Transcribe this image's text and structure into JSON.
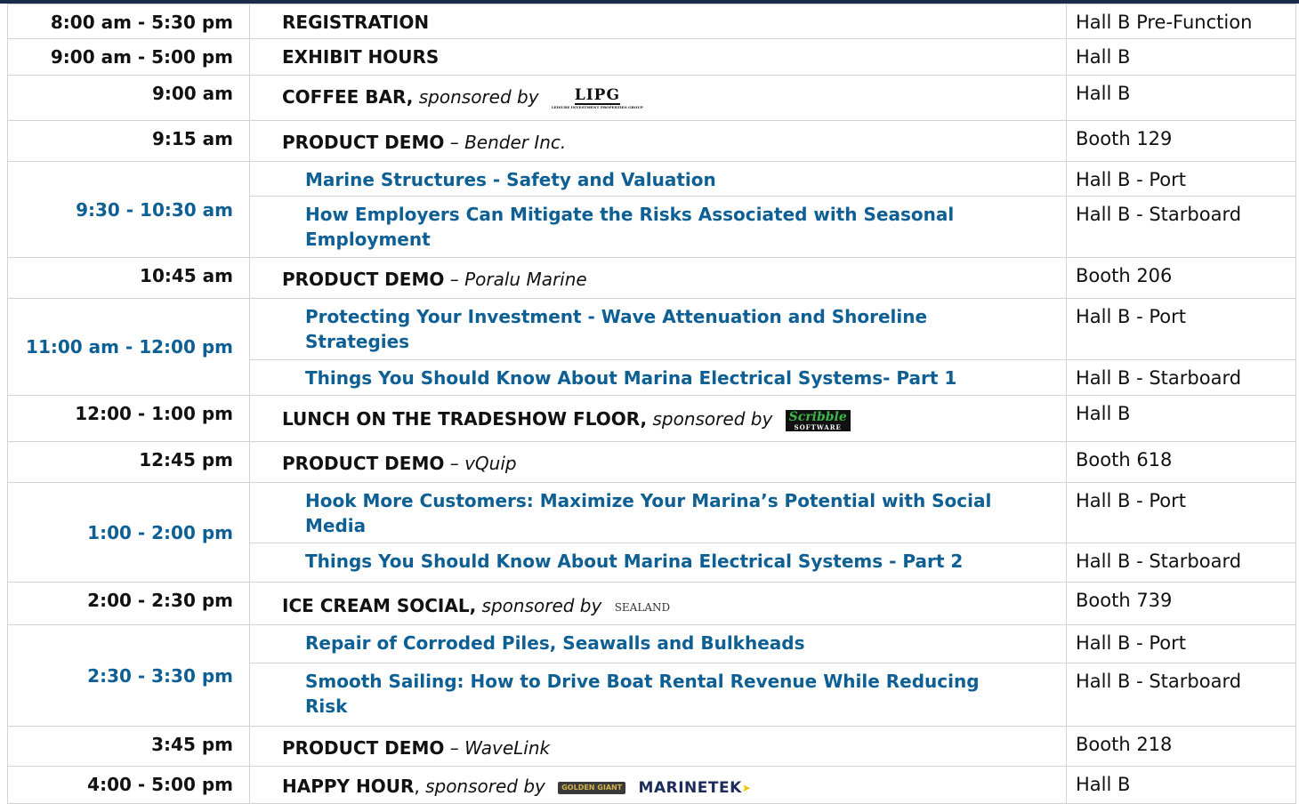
{
  "rows": [
    {
      "time": "8:00 am - 5:30 pm",
      "title": "REGISTRATION",
      "location": "Hall B Pre-Function"
    },
    {
      "time": "9:00 am - 5:00 pm",
      "title": "EXHIBIT HOURS",
      "location": "Hall B"
    },
    {
      "time": "9:00 am",
      "title": "COFFEE BAR,",
      "sponsor_text": "sponsored by",
      "logo": {
        "name": "LIPG",
        "tagline": "LEISURE INVESTMENT PROPERTIES GROUP"
      },
      "location": "Hall B"
    },
    {
      "time": "9:15 am",
      "title": "PRODUCT DEMO",
      "company": "Bender Inc.",
      "location": "Booth 129"
    },
    {
      "time": "9:30 - 10:30 am",
      "sessions": [
        {
          "title": "Marine Structures - Safety and Valuation",
          "location": "Hall B - Port"
        },
        {
          "title": "How Employers Can Mitigate the Risks Associated with Seasonal Employment",
          "location": "Hall B - Starboard"
        }
      ]
    },
    {
      "time": "10:45 am",
      "title": "PRODUCT DEMO",
      "company": "Poralu Marine",
      "location": "Booth 206"
    },
    {
      "time": "11:00 am - 12:00 pm",
      "sessions": [
        {
          "title": "Protecting Your Investment - Wave Attenuation and Shoreline Strategies",
          "location": "Hall B - Port"
        },
        {
          "title": "Things You Should Know About Marina Electrical Systems- Part 1",
          "location": "Hall B - Starboard"
        }
      ]
    },
    {
      "time": "12:00 - 1:00 pm",
      "title": "LUNCH ON THE TRADESHOW FLOOR,",
      "sponsor_text": "sponsored by",
      "logo": {
        "name": "Scribble",
        "tagline": "SOFTWARE"
      },
      "location": "Hall B"
    },
    {
      "time": "12:45 pm",
      "title": "PRODUCT DEMO",
      "company": "vQuip",
      "location": "Booth 618"
    },
    {
      "time": "1:00 - 2:00 pm",
      "sessions": [
        {
          "title": "Hook More Customers: Maximize Your Marina’s Potential with Social Media",
          "location": "Hall B - Port"
        },
        {
          "title": "Things You Should Know About Marina Electrical Systems - Part 2",
          "location": "Hall B - Starboard"
        }
      ]
    },
    {
      "time": "2:00 - 2:30 pm",
      "title": "ICE CREAM SOCIAL,",
      "sponsor_text": "sponsored by",
      "logo": {
        "name": "SEALAND"
      },
      "location": "Booth 739"
    },
    {
      "time": "2:30 - 3:30 pm",
      "sessions": [
        {
          "title": "Repair of Corroded Piles, Seawalls and Bulkheads",
          "location": "Hall B - Port"
        },
        {
          "title": "Smooth Sailing: How to Drive Boat Rental Revenue While Reducing Risk",
          "location": "Hall B - Starboard"
        }
      ]
    },
    {
      "time": "3:45 pm",
      "title": "PRODUCT DEMO",
      "company": "WaveLink",
      "location": "Booth 218"
    },
    {
      "time": "4:00 - 5:00 pm",
      "title": "HAPPY HOUR",
      "title_suffix": ",",
      "sponsor_text": "sponsored by",
      "logo": {
        "name": "GOLDEN GIANT"
      },
      "logo2": {
        "name": "MARINETEK"
      },
      "location": "Hall B"
    }
  ],
  "dash": "–",
  "colors": {
    "accent_blue": "#0d5f94",
    "top_bar": "#1a2b4c"
  }
}
